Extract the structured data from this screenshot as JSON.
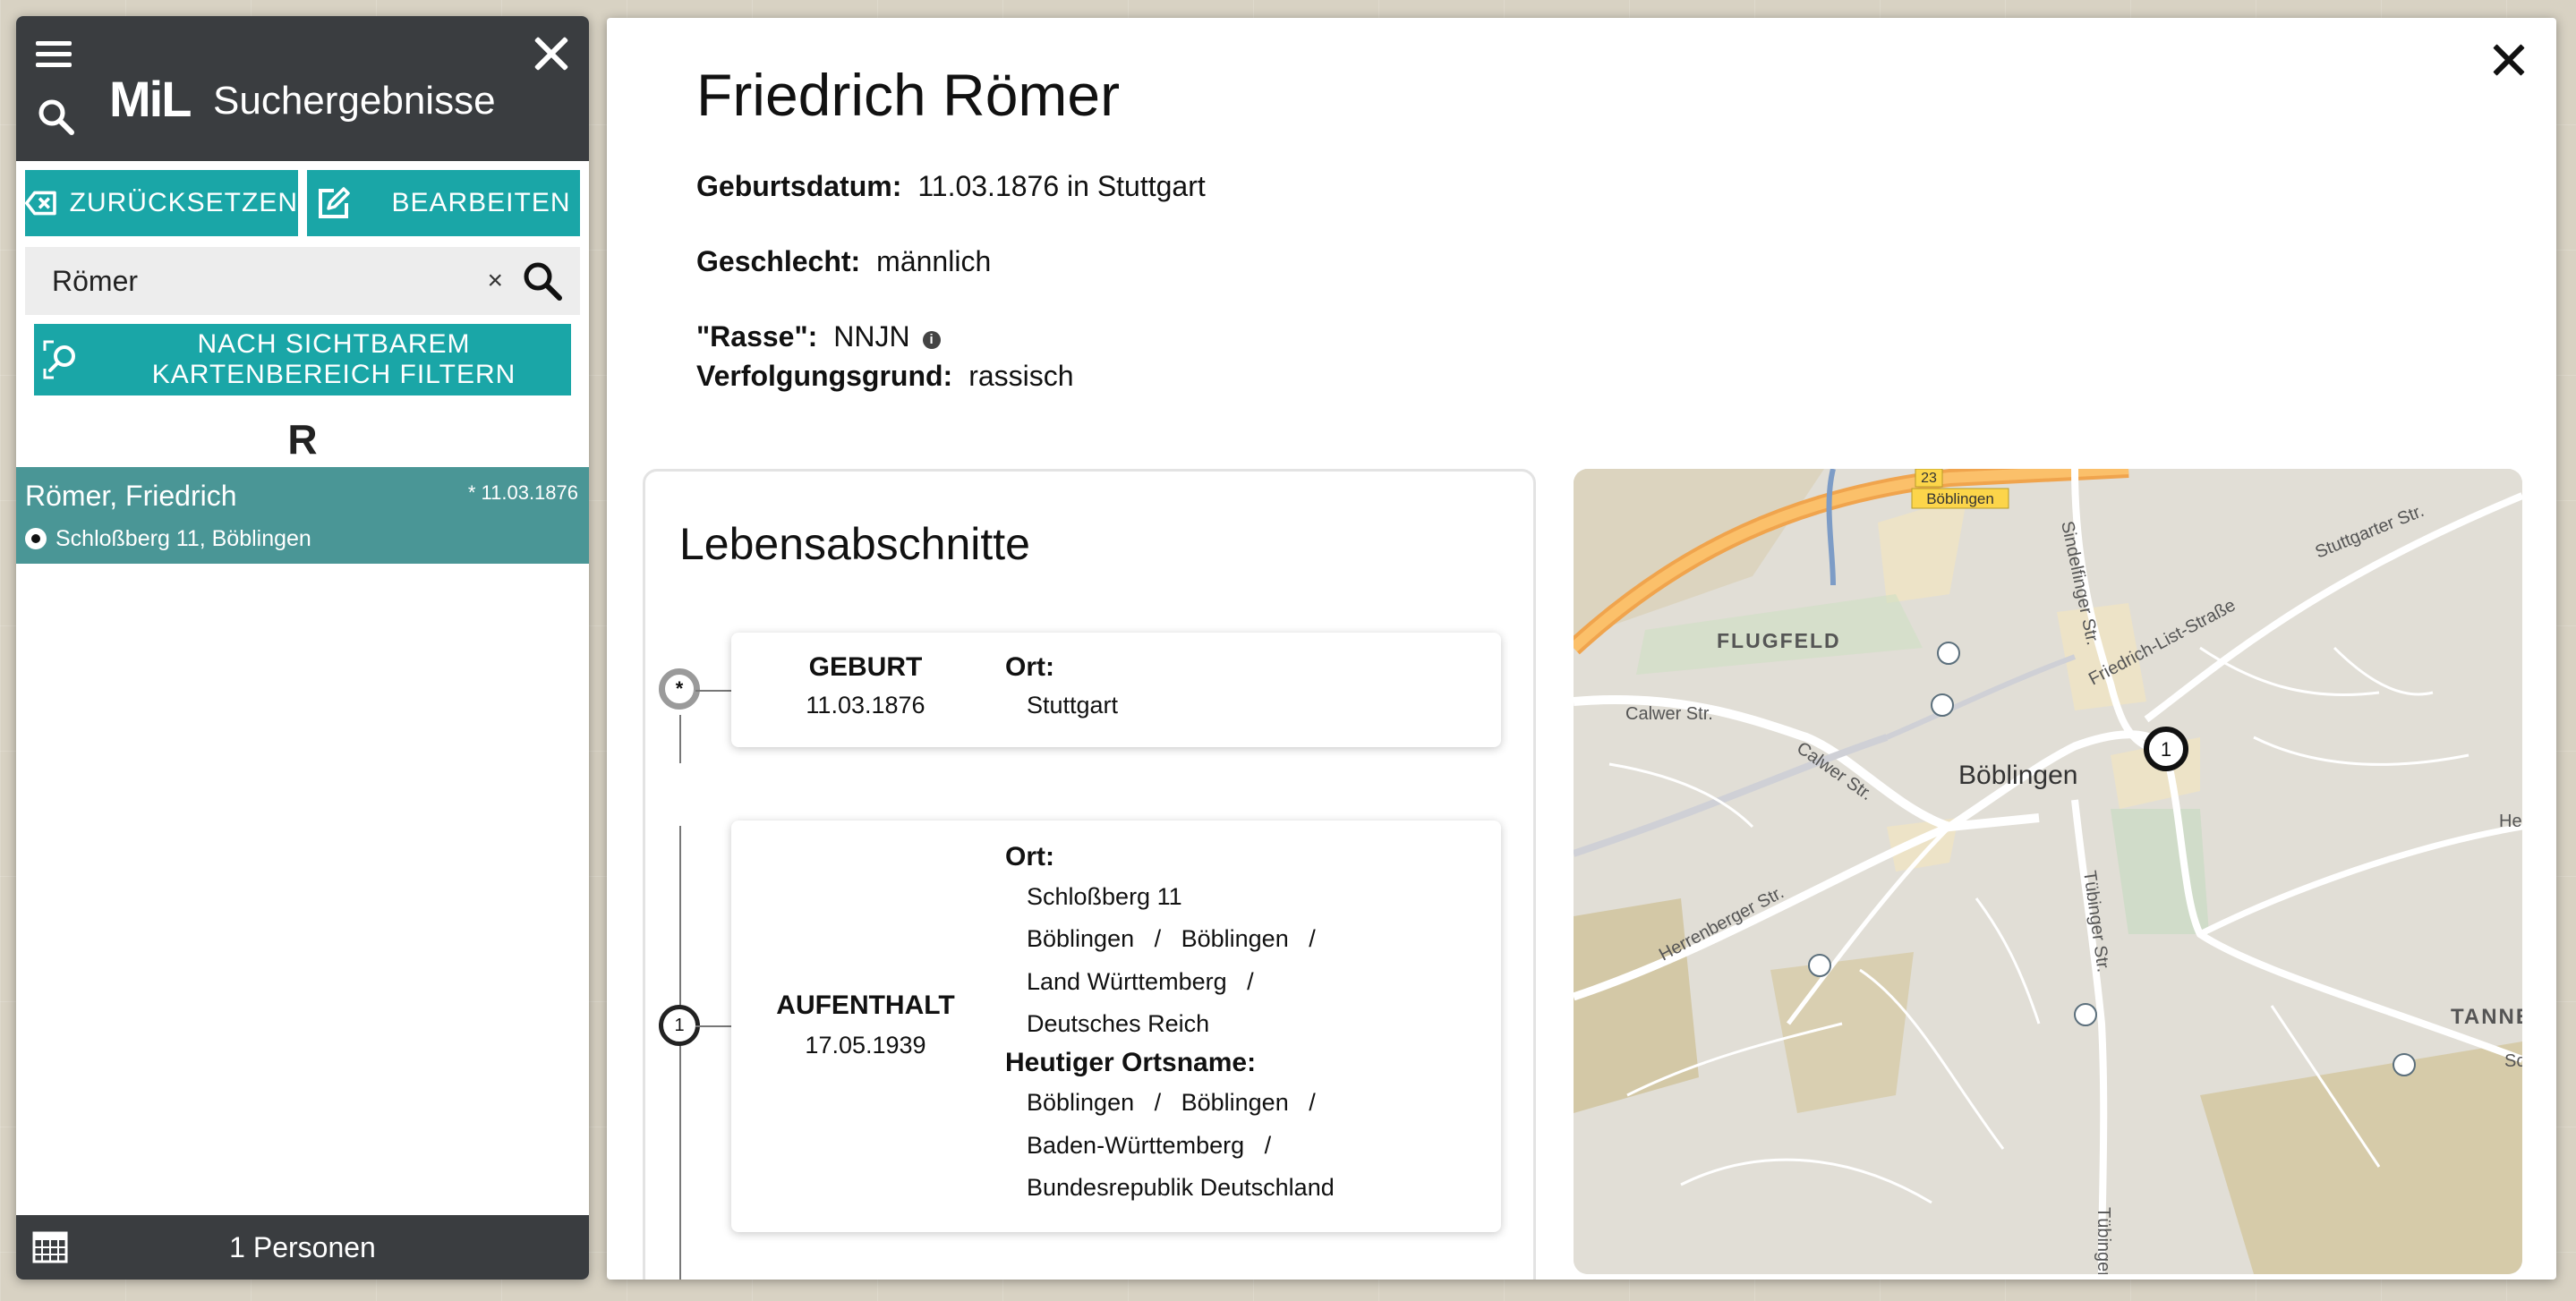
{
  "sidebar": {
    "logo": "MiL",
    "title": "Suchergebnisse",
    "reset_label": "ZURÜCKSETZEN",
    "edit_label": "BEARBEITEN",
    "search": {
      "value": "Römer",
      "clear": "×"
    },
    "filter_line1": "NACH SICHTBAREM",
    "filter_line2": "KARTENBEREICH FILTERN",
    "letter": "R",
    "results": [
      {
        "name": "Römer, Friedrich",
        "date": "* 11.03.1876",
        "address": "Schloßberg 11, Böblingen"
      }
    ],
    "footer_count": "1 Personen"
  },
  "person": {
    "name": "Friedrich Römer",
    "birth_label": "Geburtsdatum:",
    "birth_value": "11.03.1876 in Stuttgart",
    "gender_label": "Geschlecht:",
    "gender_value": "männlich",
    "race_label": "\"Rasse\":",
    "race_value": "NNJN",
    "reason_label": "Verfolgungsgrund:",
    "reason_value": "rassisch"
  },
  "timeline": {
    "title": "Lebensabschnitte",
    "entries": [
      {
        "marker": "*",
        "type": "GEBURT",
        "date": "11.03.1876",
        "ort_label": "Ort:",
        "ort_lines": [
          "Stuttgart"
        ]
      },
      {
        "marker": "1",
        "type": "AUFENTHALT",
        "date": "17.05.1939",
        "ort_label": "Ort:",
        "ort_lines": [
          "Schloßberg 11",
          "Böblingen   /   Böblingen   /",
          "Land Württemberg   /",
          "Deutsches Reich"
        ],
        "heutig_label": "Heutiger Ortsname:",
        "heutig_lines": [
          "Böblingen   /   Böblingen   /",
          "Baden-Württemberg   /",
          "Bundesrepublik Deutschland"
        ]
      }
    ]
  },
  "map": {
    "labels": {
      "flugfeld": "FLUGFELD",
      "boeblingen": "Böblingen",
      "calwer1": "Calwer Str.",
      "calwer2": "Calwer Str.",
      "herrenberger": "Herrenberger Str.",
      "sindelfinger": "Sindelfinger Str.",
      "tuebinger": "Tübinger Str.",
      "tuebinger2": "Tübinger Str.",
      "friedrich_list": "Friedrich-List-Straße",
      "stuttgarter": "Stuttgarter Str.",
      "tanne": "TANNE",
      "he": "He",
      "sc": "Sc",
      "road_no": "23",
      "road_sign": "Böblingen"
    },
    "marker": "1"
  },
  "colors": {
    "teal": "#1aa6a7",
    "result_bg": "#4a9696",
    "header_bg": "#3a3d40"
  }
}
